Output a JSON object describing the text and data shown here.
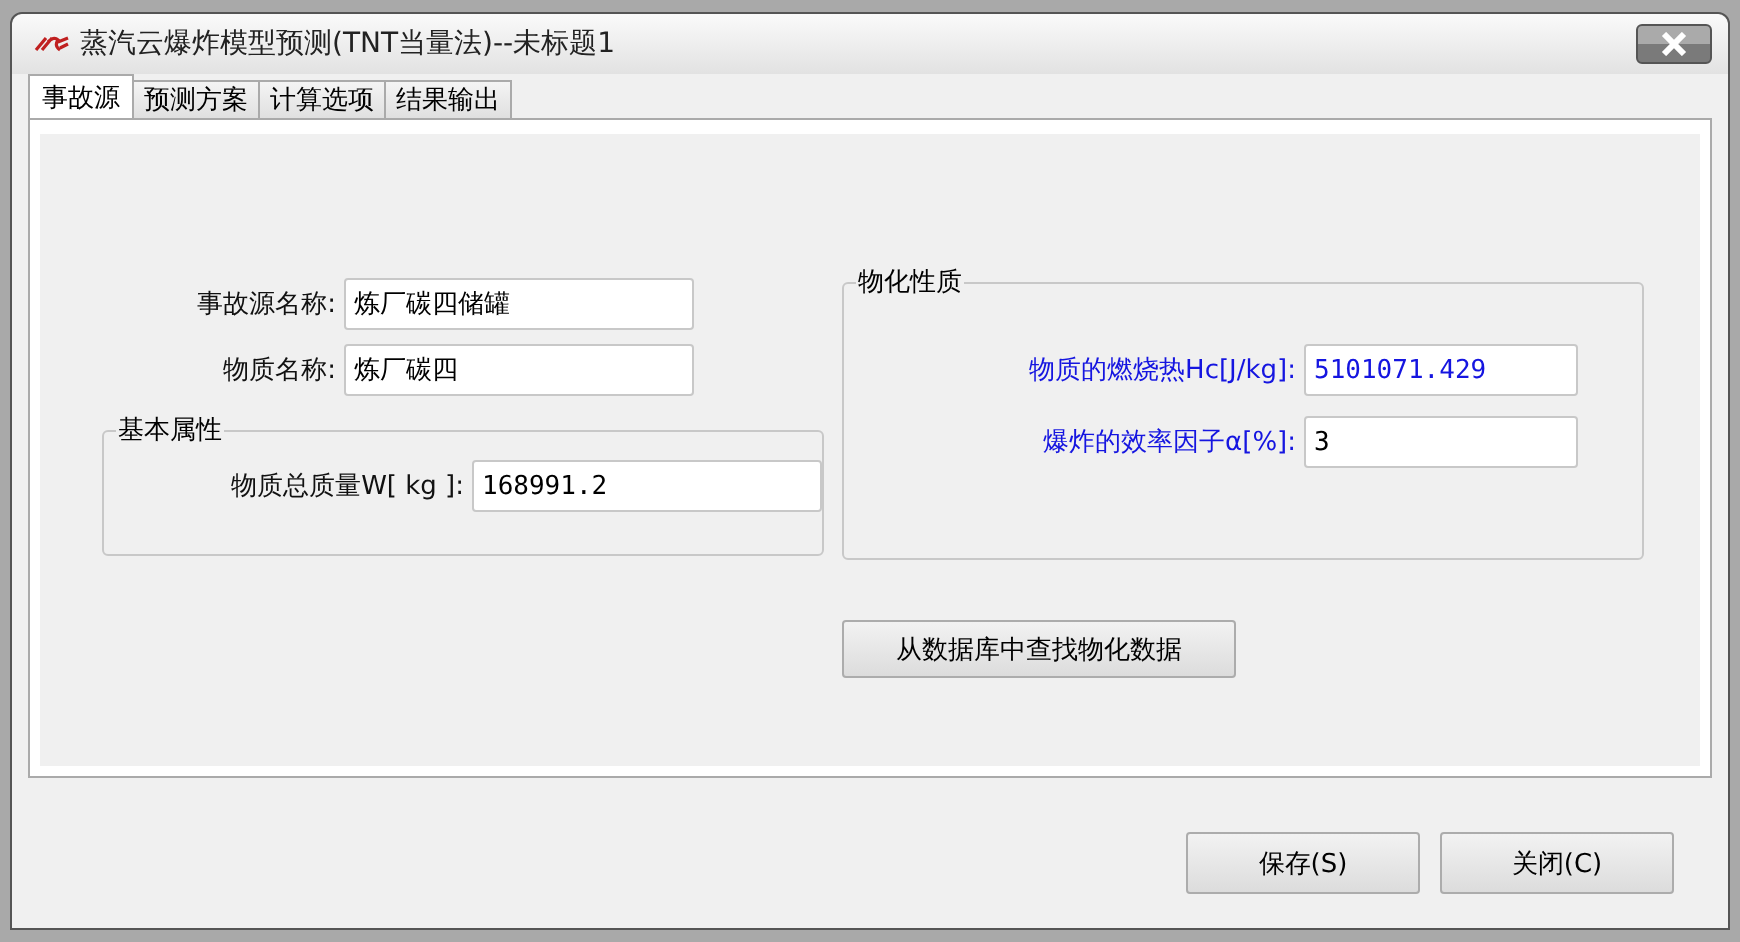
{
  "window": {
    "title": "蒸汽云爆炸模型预测(TNT当量法)--未标题1"
  },
  "tabs": [
    {
      "label": "事故源",
      "selected": true
    },
    {
      "label": "预测方案",
      "selected": false
    },
    {
      "label": "计算选项",
      "selected": false
    },
    {
      "label": "结果输出",
      "selected": false
    }
  ],
  "source_fields": [
    {
      "label": "事故源名称:",
      "value": "炼厂碳四储罐"
    },
    {
      "label": "物质名称:",
      "value": "炼厂碳四"
    }
  ],
  "basic_properties": {
    "title": "基本属性",
    "fields": [
      {
        "label": "物质总质量W[ kg ]:",
        "value": "168991.2"
      }
    ]
  },
  "physicochemical": {
    "title": "物化性质",
    "fields": [
      {
        "label": "物质的燃烧热Hc[J/kg]:",
        "value": "5101071.429"
      },
      {
        "label": "爆炸的效率因子α[%]:",
        "value": "3"
      }
    ]
  },
  "lookup_button": "从数据库中查找物化数据",
  "buttons": [
    "保存(S)",
    "关闭(C)"
  ]
}
